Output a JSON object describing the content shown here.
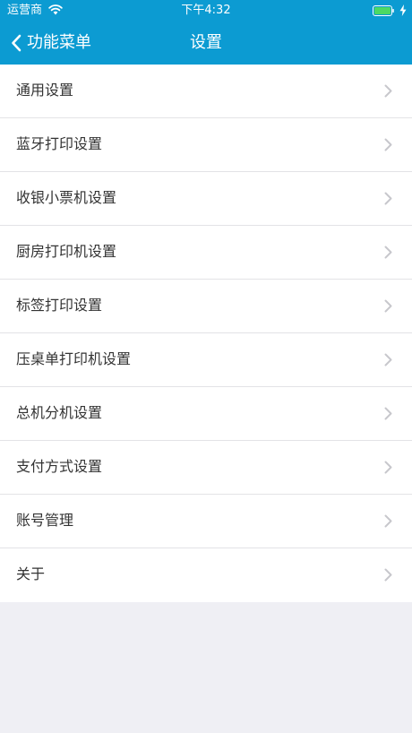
{
  "status_bar": {
    "carrier": "运营商",
    "time": "下午4:32",
    "icons": [
      "wifi-icon",
      "battery-icon",
      "charging-bolt-icon"
    ]
  },
  "nav": {
    "back_label": "功能菜单",
    "title": "设置",
    "back_icon": "chevron-left-icon"
  },
  "menu": {
    "items": [
      {
        "label": "通用设置"
      },
      {
        "label": "蓝牙打印设置"
      },
      {
        "label": "收银小票机设置"
      },
      {
        "label": "厨房打印机设置"
      },
      {
        "label": "标签打印设置"
      },
      {
        "label": "压桌单打印机设置"
      },
      {
        "label": "总机分机设置"
      },
      {
        "label": "支付方式设置"
      },
      {
        "label": "账号管理"
      },
      {
        "label": "关于"
      }
    ],
    "row_icon": "chevron-right-icon"
  },
  "colors": {
    "header": "#0c9bd2",
    "background": "#efeff4",
    "row": "#ffffff",
    "separator": "#e3e3e6",
    "text": "#333333",
    "chevron": "#c7c7cc",
    "battery_fill": "#4cd964"
  }
}
